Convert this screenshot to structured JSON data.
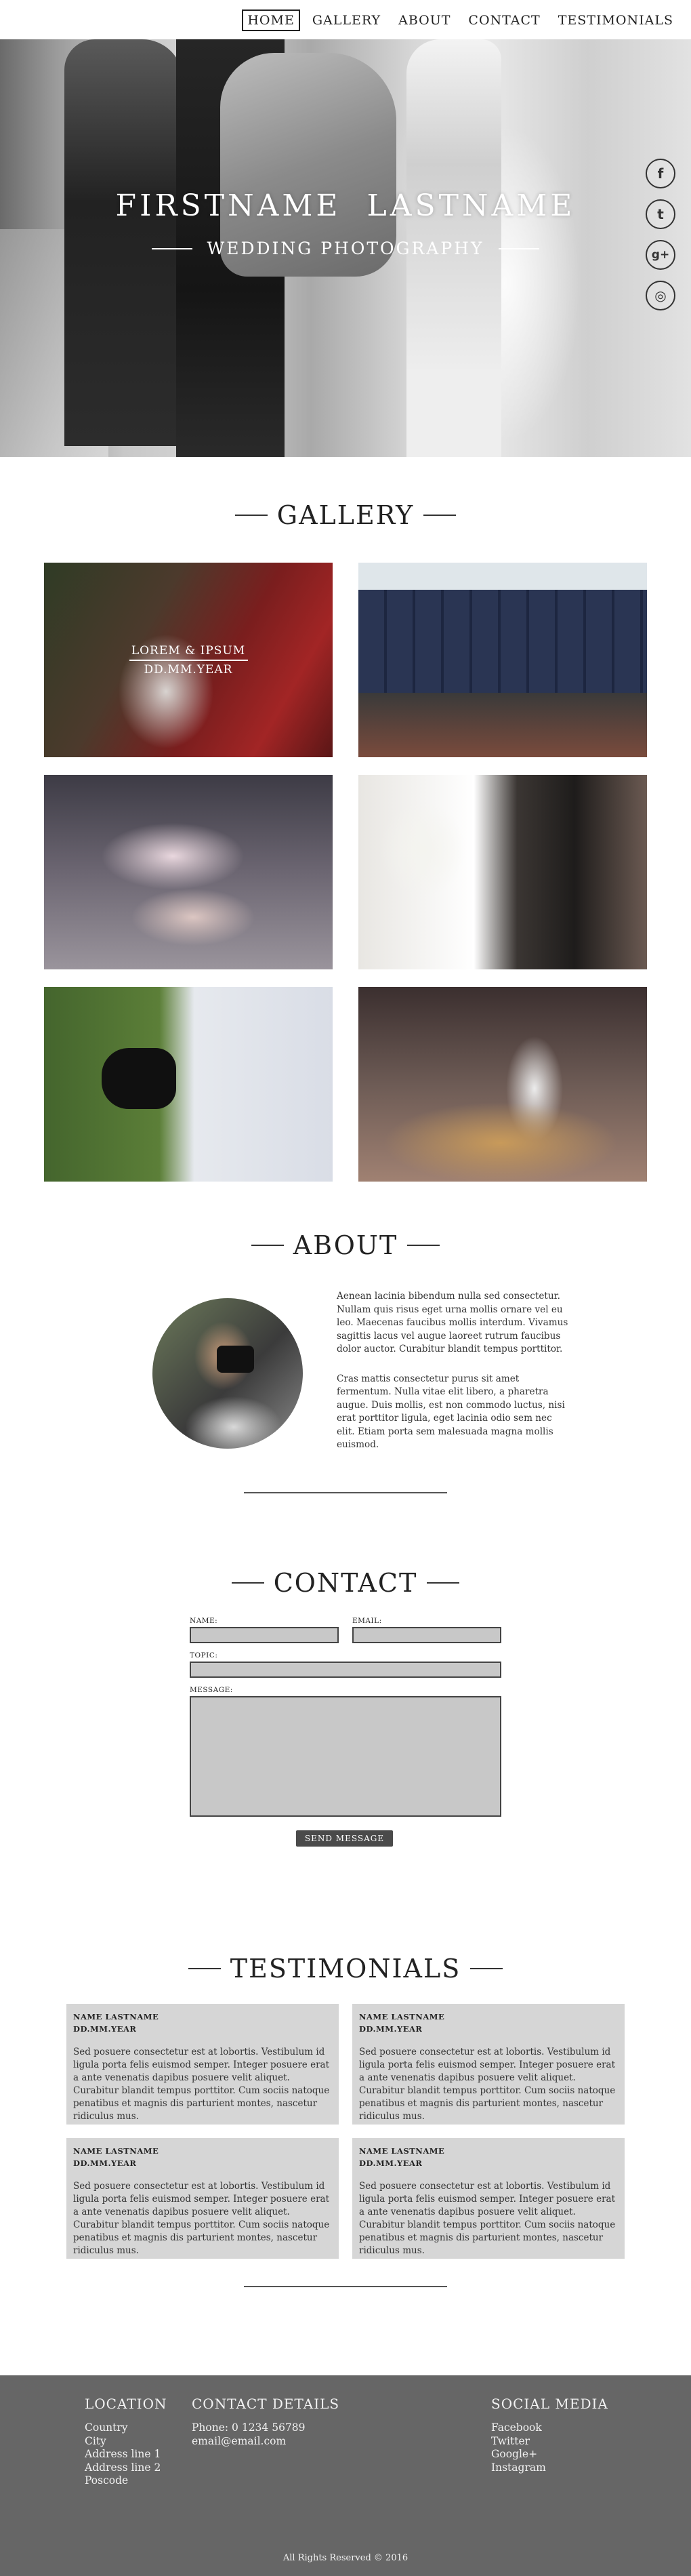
{
  "nav": {
    "items": [
      {
        "label": "HOME",
        "active": true
      },
      {
        "label": "GALLERY",
        "active": false
      },
      {
        "label": "ABOUT",
        "active": false
      },
      {
        "label": "CONTACT",
        "active": false
      },
      {
        "label": "TESTIMONIALS",
        "active": false
      }
    ]
  },
  "hero": {
    "title": "FIRSTNAME  LASTNAME",
    "subtitle": "WEDDING PHOTOGRAPHY",
    "social_icons": [
      "facebook-icon",
      "twitter-icon",
      "google-plus-icon",
      "instagram-icon"
    ],
    "social_glyphs": [
      "f",
      "t",
      "g+",
      "◎"
    ]
  },
  "gallery": {
    "heading": "GALLERY",
    "featured_caption": {
      "title": "LOREM & IPSUM",
      "date": "DD.MM.YEAR"
    },
    "images": [
      "bride-groom-autumn",
      "groomsmen-socks",
      "cupcakes-stand",
      "couple-bouquet",
      "shoes-dress-grass",
      "cake-topper"
    ]
  },
  "about": {
    "heading": "ABOUT",
    "paragraphs": [
      "Aenean lacinia bibendum nulla sed consectetur. Nullam quis risus eget urna mollis ornare vel eu leo. Maecenas faucibus mollis interdum. Vivamus sagittis lacus vel augue laoreet rutrum faucibus dolor auctor. Curabitur blandit tempus porttitor.",
      "Cras mattis consectetur purus sit amet fermentum. Nulla vitae elit libero, a pharetra augue. Duis mollis, est non commodo luctus, nisi erat porttitor ligula, eget lacinia odio sem nec elit. Etiam porta sem malesuada magna mollis euismod."
    ]
  },
  "contact": {
    "heading": "CONTACT",
    "labels": {
      "name": "NAME:",
      "email": "EMAIL:",
      "topic": "TOPIC:",
      "message": "MESSAGE:"
    },
    "values": {
      "name": "",
      "email": "",
      "topic": "",
      "message": ""
    },
    "send_label": "SEND MESSAGE"
  },
  "testimonials": {
    "heading": "TESTIMONIALS",
    "cards": [
      {
        "name": "NAME LASTNAME",
        "date": "DD.MM.YEAR",
        "text": "Sed posuere consectetur est at lobortis. Vestibulum id ligula porta felis euismod semper. Integer posuere erat a ante venenatis dapibus posuere velit aliquet. Curabitur blandit tempus porttitor. Cum sociis natoque penatibus et magnis dis parturient montes, nascetur ridiculus mus."
      },
      {
        "name": "NAME LASTNAME",
        "date": "DD.MM.YEAR",
        "text": "Sed posuere consectetur est at lobortis. Vestibulum id ligula porta felis euismod semper. Integer posuere erat a ante venenatis dapibus posuere velit aliquet. Curabitur blandit tempus porttitor. Cum sociis natoque penatibus et magnis dis parturient montes, nascetur ridiculus mus."
      },
      {
        "name": "NAME LASTNAME",
        "date": "DD.MM.YEAR",
        "text": "Sed posuere consectetur est at lobortis. Vestibulum id ligula porta felis euismod semper. Integer posuere erat a ante venenatis dapibus posuere velit aliquet. Curabitur blandit tempus porttitor. Cum sociis natoque penatibus et magnis dis parturient montes, nascetur ridiculus mus."
      },
      {
        "name": "NAME LASTNAME",
        "date": "DD.MM.YEAR",
        "text": "Sed posuere consectetur est at lobortis. Vestibulum id ligula porta felis euismod semper. Integer posuere erat a ante venenatis dapibus posuere velit aliquet. Curabitur blandit tempus porttitor. Cum sociis natoque penatibus et magnis dis parturient montes, nascetur ridiculus mus."
      }
    ]
  },
  "footer": {
    "location": {
      "heading": "LOCATION",
      "lines": [
        "Country",
        "City",
        "Address line 1",
        "Address line 2",
        "Poscode"
      ]
    },
    "contact": {
      "heading": "CONTACT DETAILS",
      "lines": [
        "Phone: 0 1234 56789",
        "email@email.com"
      ]
    },
    "social": {
      "heading": "SOCIAL MEDIA",
      "lines": [
        "Facebook",
        "Twitter",
        "Google+",
        "Instagram"
      ]
    },
    "copyright": "All Rights Reserved © 2016"
  },
  "colors": {
    "footer_bg": "#666666",
    "card_bg": "#d6d6d6",
    "field_bg": "#c8c8c8",
    "button_bg": "#4a4a4a"
  }
}
